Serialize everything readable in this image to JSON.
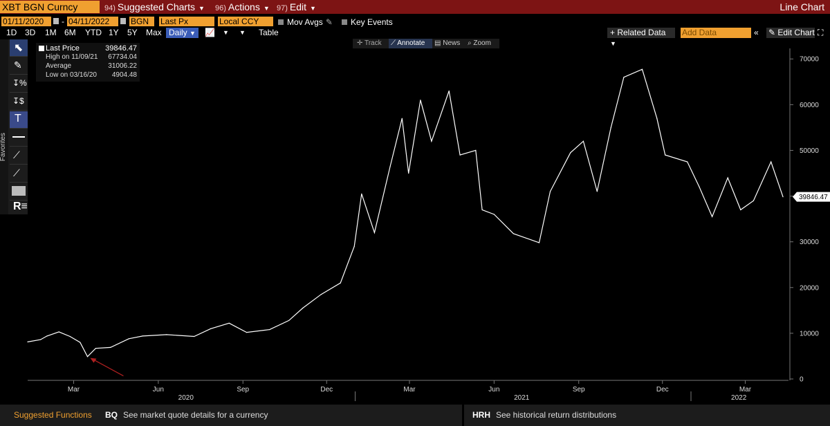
{
  "header": {
    "security": "XBT BGN Curncy",
    "menus": [
      {
        "num": "94)",
        "label": "Suggested Charts"
      },
      {
        "num": "96)",
        "label": "Actions"
      },
      {
        "num": "97)",
        "label": "Edit"
      }
    ],
    "chart_type": "Line Chart"
  },
  "controls": {
    "start_date": "01/11/2020",
    "end_date": "04/11/2022",
    "dash": "-",
    "source": "BGN",
    "field": "Last Px",
    "currency": "Local CCY",
    "mov_avgs": "Mov Avgs",
    "key_events": "Key Events",
    "ranges": [
      "1D",
      "3D",
      "1M",
      "6M",
      "YTD",
      "1Y",
      "5Y",
      "Max"
    ],
    "frequency": "Daily",
    "table": "Table",
    "related_data": "+ Related Data",
    "add_data_placeholder": "Add Data",
    "edit_chart": "Edit Chart"
  },
  "toolbar": {
    "favorites_label": "Favorites"
  },
  "annotate_bar": {
    "track": "Track",
    "annotate": "Annotate",
    "news": "News",
    "zoom": "Zoom"
  },
  "legend": {
    "last_price_label": "Last Price",
    "last_price_value": "39846.47",
    "high_label": "High on 11/09/21",
    "high_value": "67734.04",
    "average_label": "Average",
    "average_value": "31006.22",
    "low_label": "Low on 03/16/20",
    "low_value": "4904.48"
  },
  "footer": {
    "suggested": "Suggested Functions",
    "f1_code": "BQ",
    "f1_desc": "See market quote details for a currency",
    "f2_code": "HRH",
    "f2_desc": "See historical return distributions"
  },
  "chart_data": {
    "type": "line",
    "series": [
      {
        "values": [
          [
            "2020-01-11",
            8100
          ],
          [
            "2020-01-25",
            8600
          ],
          [
            "2020-02-01",
            9400
          ],
          [
            "2020-02-14",
            10300
          ],
          [
            "2020-02-26",
            9300
          ],
          [
            "2020-03-08",
            8000
          ],
          [
            "2020-03-16",
            4904
          ],
          [
            "2020-03-25",
            6700
          ],
          [
            "2020-04-10",
            6900
          ],
          [
            "2020-04-30",
            8800
          ],
          [
            "2020-05-15",
            9400
          ],
          [
            "2020-06-10",
            9700
          ],
          [
            "2020-07-10",
            9300
          ],
          [
            "2020-07-28",
            11000
          ],
          [
            "2020-08-17",
            12200
          ],
          [
            "2020-09-05",
            10200
          ],
          [
            "2020-09-30",
            10800
          ],
          [
            "2020-10-21",
            12800
          ],
          [
            "2020-11-05",
            15500
          ],
          [
            "2020-11-25",
            18500
          ],
          [
            "2020-12-16",
            21000
          ],
          [
            "2020-12-31",
            29000
          ],
          [
            "2021-01-08",
            40500
          ],
          [
            "2021-01-22",
            32000
          ],
          [
            "2021-02-08",
            46500
          ],
          [
            "2021-02-21",
            57000
          ],
          [
            "2021-02-28",
            45000
          ],
          [
            "2021-03-13",
            61000
          ],
          [
            "2021-03-25",
            52000
          ],
          [
            "2021-04-13",
            63000
          ],
          [
            "2021-04-25",
            49000
          ],
          [
            "2021-05-12",
            50000
          ],
          [
            "2021-05-19",
            37000
          ],
          [
            "2021-06-01",
            36000
          ],
          [
            "2021-06-22",
            31800
          ],
          [
            "2021-07-20",
            29800
          ],
          [
            "2021-08-01",
            41000
          ],
          [
            "2021-08-23",
            49500
          ],
          [
            "2021-09-06",
            52000
          ],
          [
            "2021-09-21",
            41000
          ],
          [
            "2021-10-06",
            55000
          ],
          [
            "2021-10-20",
            66000
          ],
          [
            "2021-11-09",
            67734
          ],
          [
            "2021-11-25",
            57000
          ],
          [
            "2021-12-04",
            49000
          ],
          [
            "2021-12-28",
            47500
          ],
          [
            "2022-01-10",
            42000
          ],
          [
            "2022-01-24",
            35500
          ],
          [
            "2022-02-10",
            44000
          ],
          [
            "2022-02-24",
            37000
          ],
          [
            "2022-03-10",
            39000
          ],
          [
            "2022-03-29",
            47500
          ],
          [
            "2022-04-11",
            39846
          ]
        ]
      }
    ],
    "x_ticks": [
      "Mar",
      "Jun",
      "Sep",
      "Dec",
      "Mar",
      "Jun",
      "Sep",
      "Dec",
      "Mar"
    ],
    "x_tick_dates": [
      "2020-03-01",
      "2020-06-01",
      "2020-09-01",
      "2020-12-01",
      "2021-03-01",
      "2021-06-01",
      "2021-09-01",
      "2021-12-01",
      "2022-03-01"
    ],
    "year_labels": [
      "2020",
      "2021",
      "2022"
    ],
    "year_label_dates": [
      "2020-07-01",
      "2021-07-01",
      "2022-02-22"
    ],
    "year_separator_dates": [
      "2021-01-01",
      "2022-01-01"
    ],
    "xlim": [
      "2020-01-11",
      "2022-04-11"
    ],
    "y_ticks": [
      0,
      10000,
      20000,
      30000,
      40000,
      50000,
      60000,
      70000
    ],
    "ylim": [
      0,
      72000
    ],
    "last_value_label": "39846.47",
    "annotation": "red arrow pointing to March 2020 low",
    "line_color": "#ffffff",
    "annotation_color": "#b02020",
    "grid": false
  }
}
